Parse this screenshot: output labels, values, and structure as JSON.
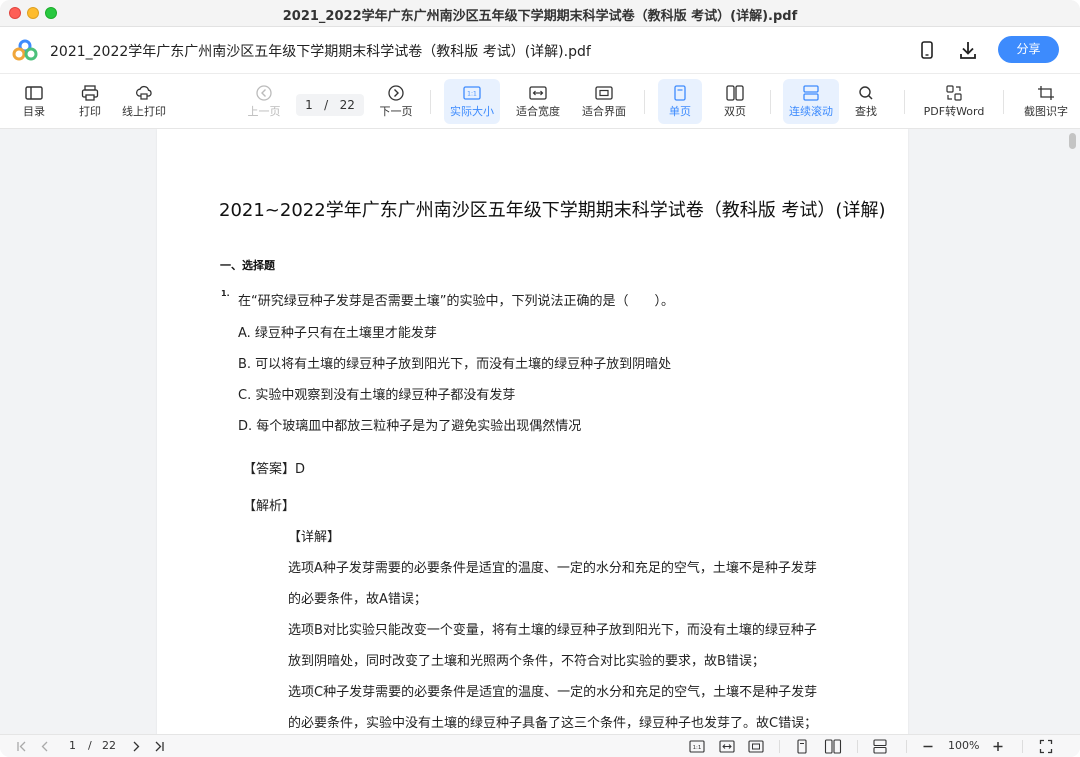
{
  "window": {
    "title": "2021_2022学年广东广州南沙区五年级下学期期末科学试卷（教科版 考试）(详解).pdf"
  },
  "header": {
    "file_name": "2021_2022学年广东广州南沙区五年级下学期期末科学试卷（教科版 考试）(详解).pdf",
    "share_label": "分享",
    "icons": [
      "app-logo",
      "phone-icon",
      "download-icon"
    ]
  },
  "toolbar": {
    "toc": "目录",
    "print": "打印",
    "online_print": "线上打印",
    "prev": "上一页",
    "page_current": "1",
    "page_sep": "/",
    "page_total": "22",
    "next": "下一页",
    "actual_size": "实际大小",
    "fit_width": "适合宽度",
    "fit_page": "适合界面",
    "single": "单页",
    "double": "双页",
    "continuous": "连续滚动",
    "find": "查找",
    "pdf_to_word": "PDF转Word",
    "ocr": "截图识字"
  },
  "document": {
    "title": "2021~2022学年广东广州南沙区五年级下学期期末科学试卷（教科版 考试）(详解)",
    "section": "一、选择题",
    "q_number": "1.",
    "question": "在“研究绿豆种子发芽是否需要土壤”的实验中，下列说法正确的是（　　）。",
    "options": [
      "A. 绿豆种子只有在土壤里才能发芽",
      "B. 可以将有土壤的绿豆种子放到阳光下，而没有土壤的绿豆种子放到阴暗处",
      "C. 实验中观察到没有土壤的绿豆种子都没有发芽",
      "D. 每个玻璃皿中都放三粒种子是为了避免实验出现偶然情况"
    ],
    "answer": "【答案】D",
    "analysis": "【解析】",
    "detail": "【详解】",
    "paragraphs": [
      "选项A种子发芽需要的必要条件是适宜的温度、一定的水分和充足的空气，土壤不是种子发芽",
      "的必要条件，故A错误；",
      "选项B对比实验只能改变一个变量，将有土壤的绿豆种子放到阳光下，而没有土壤的绿豆种子",
      "放到阴暗处，同时改变了土壤和光照两个条件，不符合对比实验的要求，故B错误；",
      "选项C种子发芽需要的必要条件是适宜的温度、一定的水分和充足的空气，土壤不是种子发芽",
      "的必要条件，实验中没有土壤的绿豆种子具备了这三个条件，绿豆种子也发芽了。故C错误；"
    ]
  },
  "bottombar": {
    "page_current": "1",
    "page_sep": "/",
    "page_total": "22",
    "zoom": "100%"
  },
  "colors": {
    "accent": "#3d8bfd",
    "active_bg": "#e8f1fe"
  }
}
